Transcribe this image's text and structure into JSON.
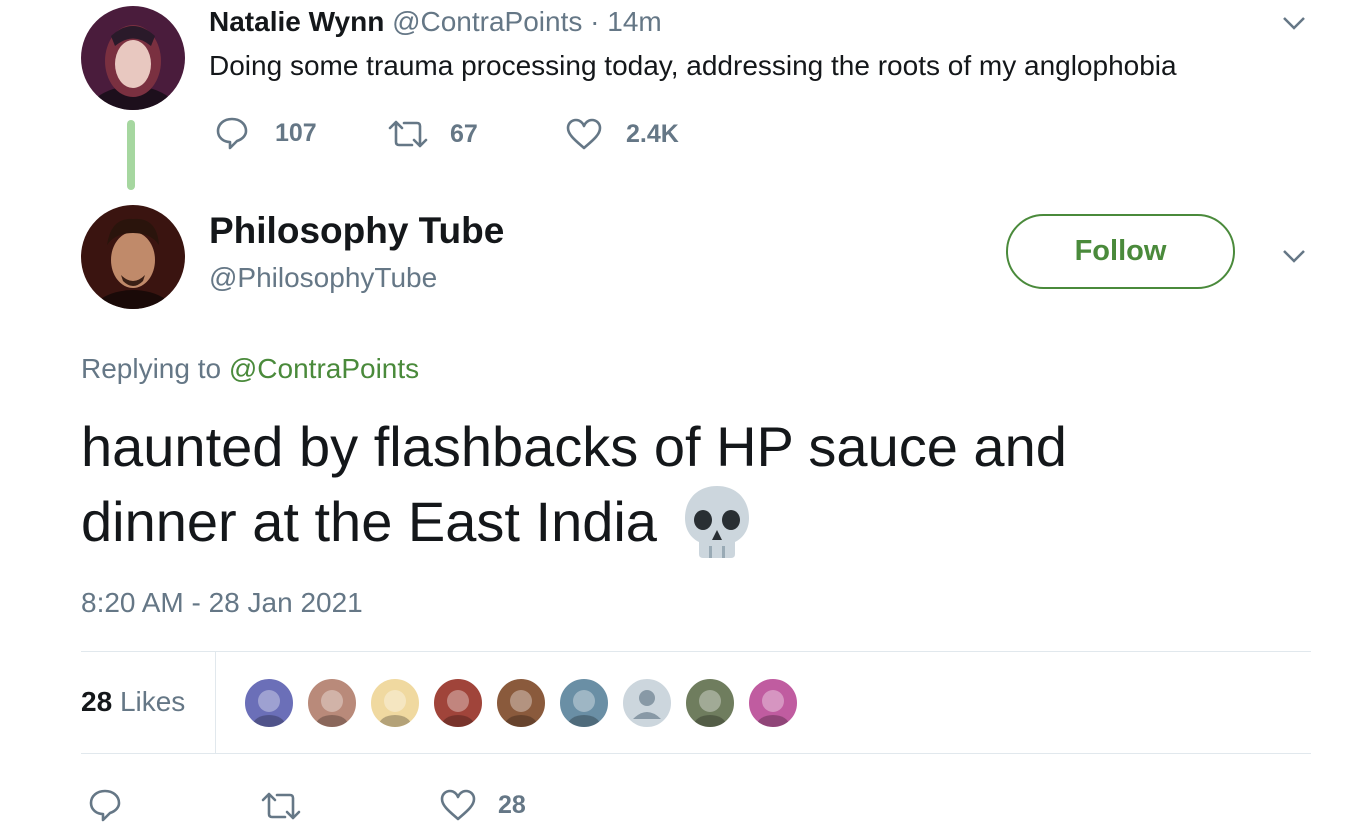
{
  "parent_tweet": {
    "name": "Natalie Wynn",
    "handle": "@ContraPoints",
    "separator": "·",
    "time": "14m",
    "text": "Doing some trauma processing today, addressing the roots of my anglophobia",
    "replies": "107",
    "retweets": "67",
    "likes": "2.4K"
  },
  "tweet": {
    "name": "Philosophy Tube",
    "handle": "@PhilosophyTube",
    "follow_label": "Follow",
    "replying_prefix": "Replying to",
    "replying_handle": "@ContraPoints",
    "text_line1": "haunted by flashbacks of HP sauce and",
    "text_line2": "dinner at the East India",
    "timestamp": "8:20 AM - 28 Jan 2021",
    "likes_count": "28",
    "likes_label": "Likes",
    "action_likes": "28"
  },
  "likers": [
    {
      "icon": "teletubby-avatar",
      "color": "#6b6fb8"
    },
    {
      "icon": "face-avatar",
      "color": "#b98a7a"
    },
    {
      "icon": "cartoon-avatar",
      "color": "#f0d9a0"
    },
    {
      "icon": "redhead-avatar",
      "color": "#a0443a"
    },
    {
      "icon": "face-avatar",
      "color": "#8a5a3c"
    },
    {
      "icon": "group-avatar",
      "color": "#6a8fa5"
    },
    {
      "icon": "default-avatar",
      "color": "#ccd6dd"
    },
    {
      "icon": "goose-meme-avatar",
      "color": "#6f7d5e"
    },
    {
      "icon": "pink-creature-avatar",
      "color": "#c05ca0"
    }
  ],
  "colors": {
    "accent_green": "#4a8a3b",
    "thread_line": "#a6d7a0",
    "muted": "#657786"
  }
}
